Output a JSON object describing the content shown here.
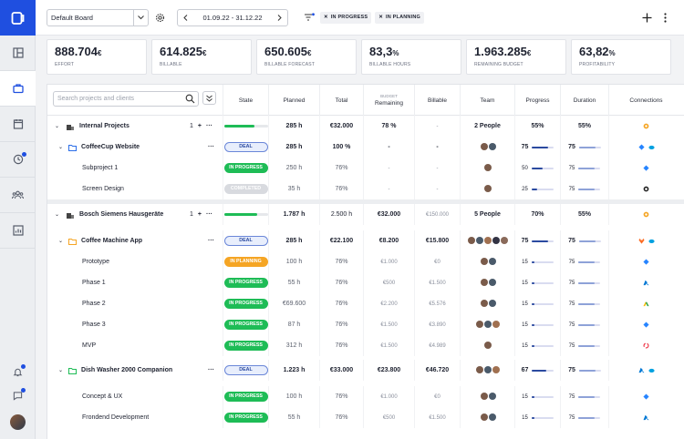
{
  "toolbar": {
    "board": "Default Board",
    "date_range": "01.09.22 - 31.12.22",
    "filters": [
      "IN PROGRESS",
      "IN PLANNING"
    ]
  },
  "kpis": [
    {
      "value": "888.704",
      "unit": "€",
      "label": "EFFORT"
    },
    {
      "value": "614.825",
      "unit": "€",
      "label": "BILLABLE"
    },
    {
      "value": "650.605",
      "unit": "€",
      "label": "BILLABLE FORECAST"
    },
    {
      "value": "83,3",
      "unit": "%",
      "label": "BILLABLE HOURS"
    },
    {
      "value": "1.963.285",
      "unit": "€",
      "label": "REMAINING BUDGET"
    },
    {
      "value": "63,82",
      "unit": "%",
      "label": "PROFITABILITY"
    }
  ],
  "table": {
    "search_placeholder": "Search projects and clients",
    "budget_label": "BUDGET",
    "columns": [
      "State",
      "Planned",
      "Total",
      "Remaining",
      "Billable",
      "Team",
      "Progress",
      "Duration",
      "Connections"
    ],
    "groups": [
      {
        "name": "Internal Projects",
        "count": "1",
        "planned": "285 h",
        "total": "€32.000",
        "remaining": "78 %",
        "billable": "-",
        "team": "2 People",
        "progress": "55%",
        "duration": "55%",
        "gbar": 0.7
      },
      {
        "name": "Bosch Siemens Hausgeräte",
        "count": "1",
        "planned": "1.787 h",
        "total": "2.500 h",
        "remaining": "€32.000",
        "billable": "€150.000",
        "team": "5 People",
        "progress": "70%",
        "duration": "55%",
        "gbar": 0.75
      }
    ],
    "rows": [
      {
        "name": "CoffeeCup Website",
        "level": 1,
        "state": "DEAL",
        "planned": "285 h",
        "total": "100 %",
        "remaining": "-",
        "billable": "-",
        "avatars": 2,
        "progress": "75",
        "prog_f": 0.75,
        "duration": "75",
        "dur_f": 0.75
      },
      {
        "name": "Subproject 1",
        "level": 2,
        "state": "IN PROGRESS",
        "planned": "250 h",
        "total": "76%",
        "remaining": "-",
        "billable": "-",
        "avatars": 1,
        "progress": "50",
        "prog_f": 0.5,
        "duration": "75",
        "dur_f": 0.75
      },
      {
        "name": "Screen Design",
        "level": 2,
        "state": "COMPLETED",
        "planned": "35 h",
        "total": "76%",
        "remaining": "-",
        "billable": "-",
        "avatars": 1,
        "progress": "25",
        "prog_f": 0.25,
        "duration": "75",
        "dur_f": 0.75
      },
      {
        "name": "Coffee Machine App",
        "level": 1,
        "state": "DEAL",
        "planned": "285 h",
        "total": "€22.100",
        "remaining": "€8.200",
        "billable": "€15.800",
        "avatars": 5,
        "progress": "75",
        "prog_f": 0.75,
        "duration": "75",
        "dur_f": 0.75
      },
      {
        "name": "Prototype",
        "level": 2,
        "state": "IN PLANNING",
        "planned": "100 h",
        "total": "76%",
        "remaining": "€1.000",
        "billable": "€0",
        "avatars": 2,
        "progress": "15",
        "prog_f": 0.15,
        "duration": "75",
        "dur_f": 0.75
      },
      {
        "name": "Phase 1",
        "level": 2,
        "state": "IN PROGRESS",
        "planned": "55 h",
        "total": "76%",
        "remaining": "€500",
        "billable": "€1.500",
        "avatars": 2,
        "progress": "15",
        "prog_f": 0.15,
        "duration": "75",
        "dur_f": 0.75
      },
      {
        "name": "Phase 2",
        "level": 2,
        "state": "IN PROGRESS",
        "planned": "€69.600",
        "total": "76%",
        "remaining": "€2.200",
        "billable": "€5.576",
        "avatars": 2,
        "progress": "15",
        "prog_f": 0.15,
        "duration": "75",
        "dur_f": 0.75
      },
      {
        "name": "Phase 3",
        "level": 2,
        "state": "IN PROGRESS",
        "planned": "87 h",
        "total": "76%",
        "remaining": "€1.500",
        "billable": "€3.890",
        "avatars": 3,
        "progress": "15",
        "prog_f": 0.15,
        "duration": "75",
        "dur_f": 0.75
      },
      {
        "name": "MVP",
        "level": 2,
        "state": "IN PROGRESS",
        "planned": "312 h",
        "total": "76%",
        "remaining": "€1.500",
        "billable": "€4.989",
        "avatars": 1,
        "progress": "15",
        "prog_f": 0.15,
        "duration": "75",
        "dur_f": 0.75
      },
      {
        "name": "Dish Washer 2000 Companion",
        "level": 1,
        "state": "DEAL",
        "planned": "1.223 h",
        "total": "€33.000",
        "remaining": "€23.800",
        "billable": "€46.720",
        "avatars": 3,
        "progress": "67",
        "prog_f": 0.67,
        "duration": "75",
        "dur_f": 0.75
      },
      {
        "name": "Concept & UX",
        "level": 2,
        "state": "IN PROGRESS",
        "planned": "100 h",
        "total": "76%",
        "remaining": "€1.000",
        "billable": "€0",
        "avatars": 2,
        "progress": "15",
        "prog_f": 0.15,
        "duration": "75",
        "dur_f": 0.75
      },
      {
        "name": "Frondend Development",
        "level": 2,
        "state": "IN PROGRESS",
        "planned": "55 h",
        "total": "76%",
        "remaining": "€500",
        "billable": "€1.500",
        "avatars": 2,
        "progress": "15",
        "prog_f": 0.15,
        "duration": "75",
        "dur_f": 0.75
      }
    ]
  },
  "colors": {
    "accent": "#1f4fe0",
    "progress": "#1ebc56",
    "planning": "#f5a524",
    "deal_bg": "#e8eefc"
  }
}
